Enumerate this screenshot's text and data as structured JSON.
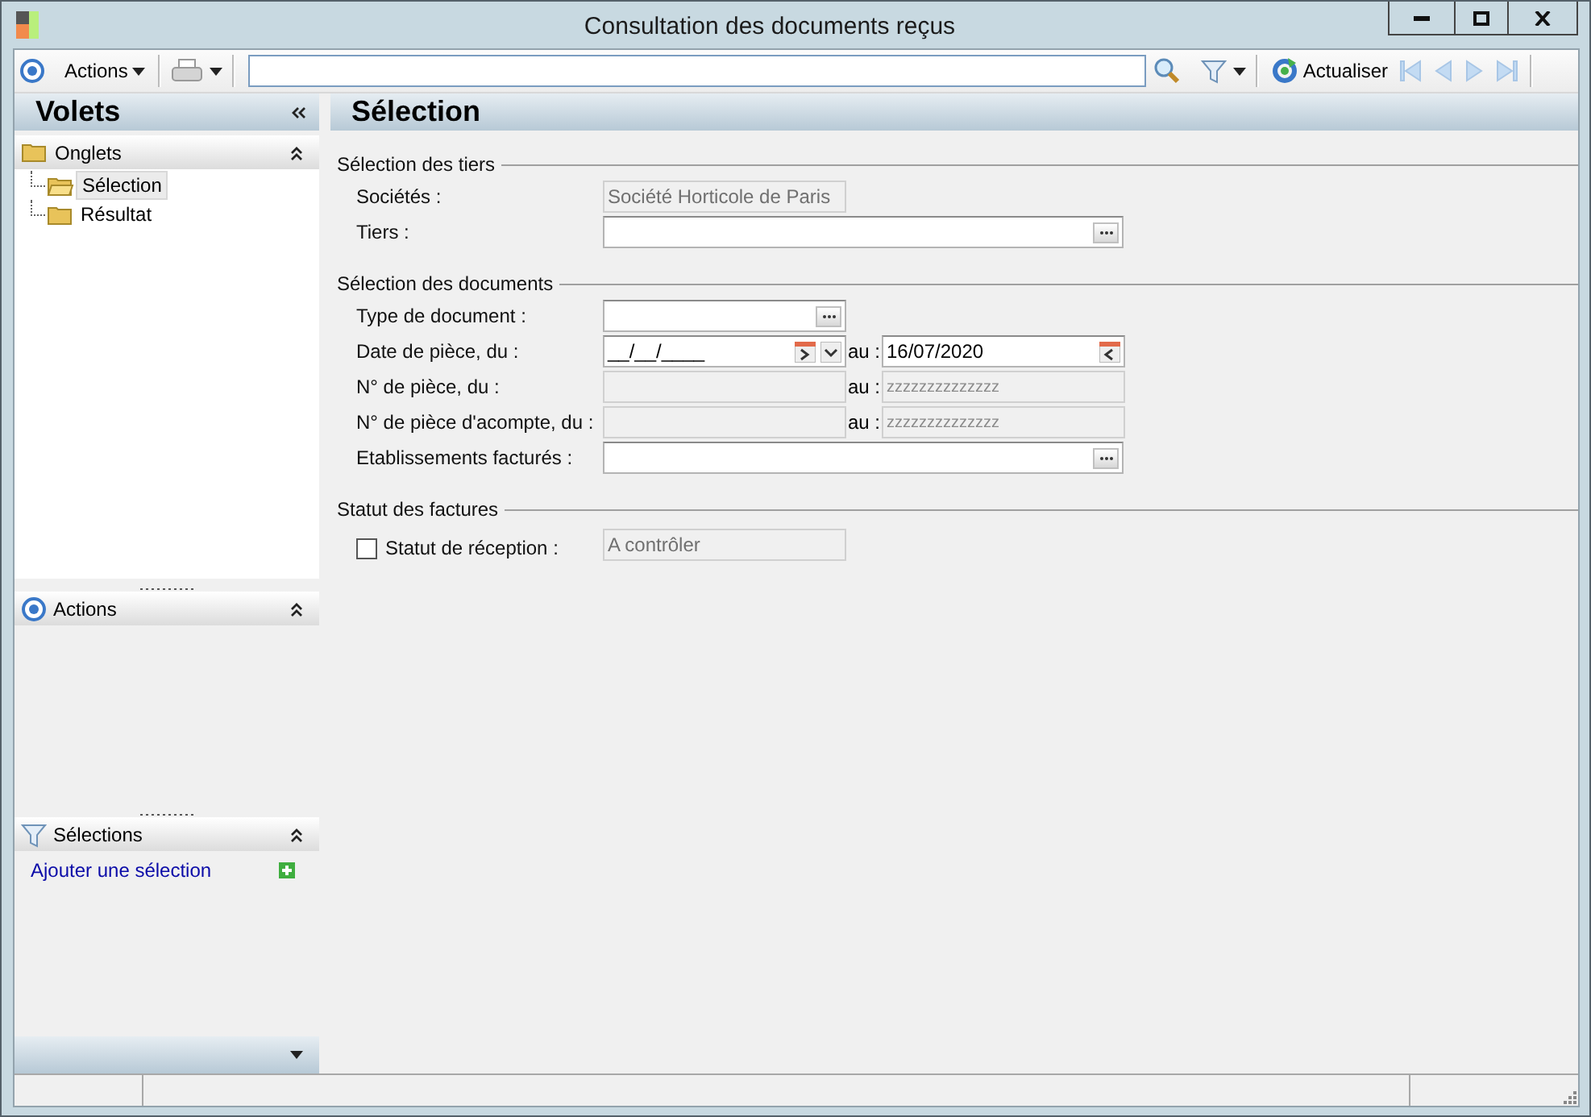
{
  "window": {
    "title": "Consultation des documents reçus"
  },
  "toolbar": {
    "actions_label": "Actions",
    "refresh_label": "Actualiser"
  },
  "sidebar": {
    "title": "Volets",
    "panels": [
      {
        "kind": "tree",
        "title": "Onglets",
        "expanded": true,
        "items": [
          {
            "label": "Sélection",
            "selected": true
          },
          {
            "label": "Résultat",
            "selected": false
          }
        ]
      },
      {
        "kind": "actions",
        "title": "Actions",
        "expanded": true
      },
      {
        "kind": "selections",
        "title": "Sélections",
        "expanded": true,
        "link": "Ajouter une sélection"
      }
    ]
  },
  "content": {
    "title": "Sélection",
    "groups": [
      {
        "title": "Sélection des tiers",
        "rows": [
          {
            "kind": "readonly",
            "label": "Sociétés :",
            "value": "Société Horticole de Paris"
          },
          {
            "kind": "lookup",
            "label": "Tiers :"
          }
        ]
      },
      {
        "title": "Sélection des documents",
        "rows": [
          {
            "kind": "short_lookup",
            "label": "Type de document :"
          },
          {
            "kind": "date_range",
            "label": "Date de pièce, du :",
            "value": "__/__/____",
            "to_label": "au :",
            "to_value": "16/07/2020"
          },
          {
            "kind": "range",
            "label": "N° de pièce, du :",
            "to_label": "au :",
            "to_value": "zzzzzzzzzzzzzz"
          },
          {
            "kind": "range",
            "label": "N° de pièce d'acompte, du :",
            "to_label": "au :",
            "to_value": "zzzzzzzzzzzzzz"
          },
          {
            "kind": "lookup",
            "label": "Etablissements facturés :"
          }
        ]
      },
      {
        "title": "Statut des factures",
        "rows": [
          {
            "kind": "check_readonly",
            "label": "Statut de réception :",
            "checked": false,
            "value": "A contrôler"
          }
        ]
      }
    ]
  }
}
